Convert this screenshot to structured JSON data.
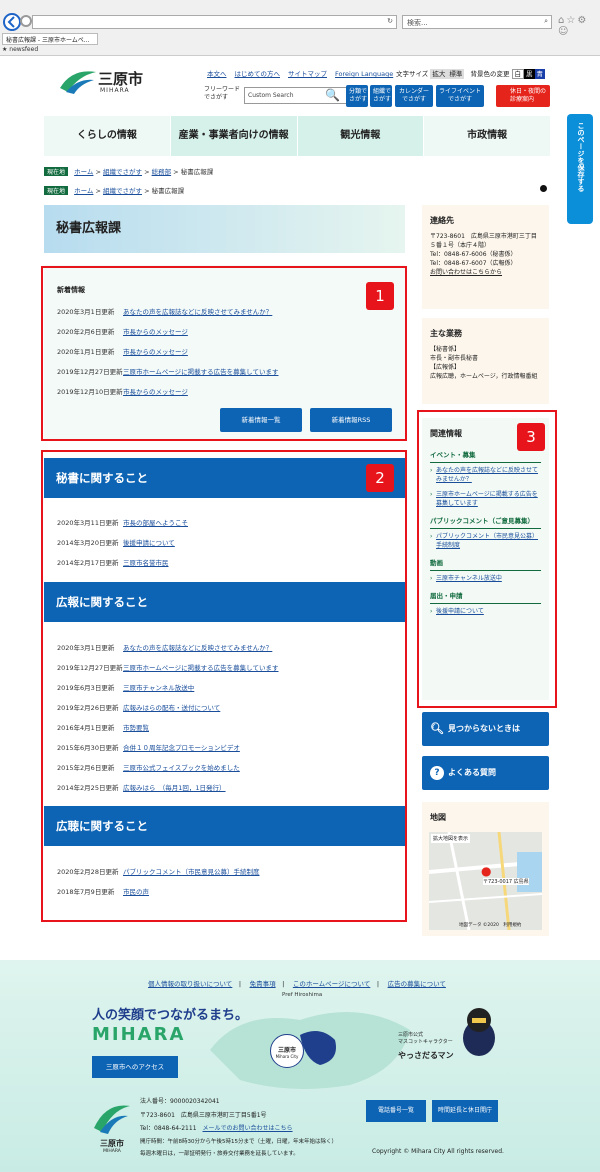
{
  "browser": {
    "search_placeholder": "検索...",
    "tab_title": "秘書広報課 - 三原市ホームペ...",
    "favorites": "newsfeed"
  },
  "header": {
    "logo_text": "三原市",
    "logo_sub": "MIHARA",
    "links": [
      "本文へ",
      "はじめての方へ",
      "サイトマップ",
      "Foreign Language"
    ],
    "text_size_label": "文字サイズ",
    "size_big": "拡大",
    "size_std": "標準",
    "bg_label": "背景色の変更",
    "bg_white": "白",
    "bg_black": "黒",
    "bg_blue": "青",
    "freeword_label": "フリーワード\nでさがす",
    "search_placeholder": "Custom Search",
    "btn_field": "分類で\nさがす",
    "btn_org": "組織で\nさがす",
    "btn_calendar": "カレンダー\nでさがす",
    "btn_life": "ライフイベント\nでさがす",
    "btn_clinic": "休日・夜間の\n診療案内"
  },
  "gnav": [
    "くらしの情報",
    "産業・事業者向けの情報",
    "観光情報",
    "市政情報"
  ],
  "breadcrumb1": {
    "label": "現在地",
    "items": [
      "ホーム",
      "組織でさがす",
      "総務部"
    ],
    "current": "秘書広報課"
  },
  "breadcrumb2": {
    "label": "現在地",
    "items": [
      "ホーム",
      "組織でさがす"
    ],
    "current": "秘書広報課"
  },
  "save_tab": "このページを保存する",
  "page_title": "秘書広報課",
  "news": {
    "heading": "新着情報",
    "rows": [
      {
        "date": "2020年3月1日更新",
        "text": "あなたの声を広報誌などに反映させてみませんか？"
      },
      {
        "date": "2020年2月6日更新",
        "text": "市長からのメッセージ"
      },
      {
        "date": "2020年1月1日更新",
        "text": "市長からのメッセージ"
      },
      {
        "date": "2019年12月27日更新",
        "text": "三原市ホームページに掲載する広告を募集しています"
      },
      {
        "date": "2019年12月10日更新",
        "text": "市長からのメッセージ"
      }
    ],
    "btn_list": "新着情報一覧",
    "btn_rss": "新着情報RSS"
  },
  "sections": [
    {
      "title": "秘書に関すること",
      "rows": [
        {
          "date": "2020年3月11日更新",
          "text": "市長の部屋へようこそ"
        },
        {
          "date": "2014年3月20日更新",
          "text": "後援申請について"
        },
        {
          "date": "2014年2月17日更新",
          "text": "三原市名誉市民"
        }
      ]
    },
    {
      "title": "広報に関すること",
      "rows": [
        {
          "date": "2020年3月1日更新",
          "text": "あなたの声を広報誌などに反映させてみませんか？"
        },
        {
          "date": "2019年12月27日更新",
          "text": "三原市ホームページに掲載する広告を募集しています"
        },
        {
          "date": "2019年6月3日更新",
          "text": "三原市チャンネル放送中"
        },
        {
          "date": "2019年2月26日更新",
          "text": "広報みはらの配布・送付について"
        },
        {
          "date": "2016年4月1日更新",
          "text": "市勢要覧"
        },
        {
          "date": "2015年6月30日更新",
          "text": "合併１０周年記念プロモーションビデオ"
        },
        {
          "date": "2015年2月6日更新",
          "text": "三原市公式フェイスブックを始めました"
        },
        {
          "date": "2014年2月25日更新",
          "text": "広報みはら　（毎月1回，1日発行）"
        }
      ]
    },
    {
      "title": "広聴に関すること",
      "rows": [
        {
          "date": "2020年2月28日更新",
          "text": "パブリックコメント（市民意見公募）手続制度"
        },
        {
          "date": "2018年7月9日更新",
          "text": "市民の声"
        }
      ]
    }
  ],
  "contact": {
    "heading": "連絡先",
    "lines": [
      "〒723-8601　広島県三原市港町三丁目",
      "５番１号（本庁４階）",
      "Tel：0848-67-6006（秘書係）",
      "Tel：0848-67-6007（広報係）"
    ],
    "link": "お問い合わせはこちらから"
  },
  "duties": {
    "heading": "主な業務",
    "lines": [
      "【秘書係】",
      "市長・副市長秘書",
      "【広報係】",
      "広報広聴，ホームページ，行政情報番組"
    ]
  },
  "related": {
    "heading": "関連情報",
    "groups": [
      {
        "title": "イベント・募集",
        "items": [
          "あなたの声を広報誌などに反映させてみませんか？",
          "三原市ホームページに掲載する広告を募集しています"
        ]
      },
      {
        "title": "パブリックコメント（ご意見募集）",
        "items": [
          "パブリックコメント（市民意見公募）手続制度"
        ]
      },
      {
        "title": "動画",
        "items": [
          "三原市チャンネル放送中"
        ]
      },
      {
        "title": "届出・申請",
        "items": [
          "後援申請について"
        ]
      }
    ]
  },
  "btn_notfound": "見つからないときは",
  "btn_faq": "よくある質問",
  "map": {
    "heading": "地図",
    "enlarge": "拡大地図を表示",
    "marker": "〒723-0017 広島県",
    "credit": "地図データ ©2020　利用規約"
  },
  "markers": [
    "1",
    "2",
    "3"
  ],
  "footer": {
    "links": [
      "個人情報の取り扱いについて",
      "免責事項",
      "このホームページについて",
      "広告の募集について"
    ],
    "slogan": "人の笑顔でつながるまち。",
    "brand": "MIHARA",
    "access_btn": "三原市へのアクセス",
    "pref": "Pref Hiroshima",
    "map_label": "三原市",
    "map_sub": "Mihara City",
    "mascot_label": "三原市公式\nマスコットキャラクター",
    "mascot_name": "やっさだるマン",
    "corp_no": "法人番号：9000020342041",
    "address": "〒723-8601　広島県三原市港町三丁目5番1号",
    "tel": "Tel：0848-64-2111",
    "mail": "メールでのお問い合わせはこちら",
    "hours": "開庁時間：午前8時30分から午後5時15分まで（土曜，日曜，年末年始は除く）",
    "hours2": "毎週木曜日は，一部証明発行・旅券交付業務を延長しています。",
    "btn_phone": "電話番号一覧",
    "btn_hours": "時間延長と休日開庁",
    "copyright": "Copyright © Mihara City All rights reserved."
  }
}
